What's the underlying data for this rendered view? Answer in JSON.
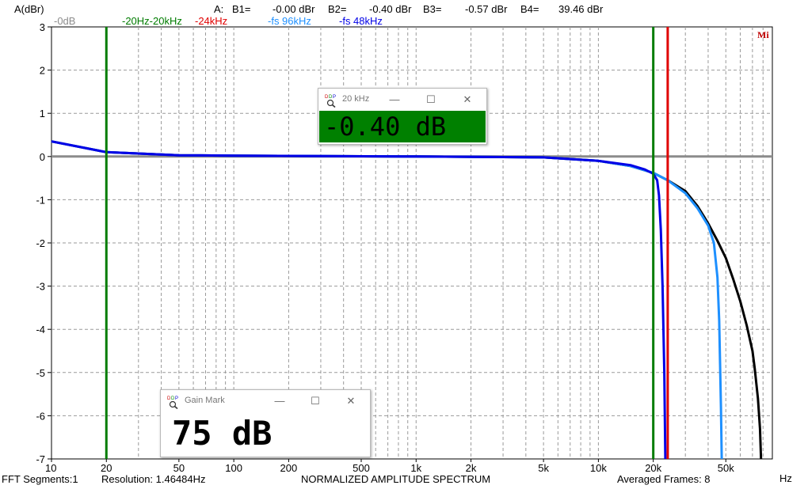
{
  "header": {
    "y_axis_label": "A(dBr)",
    "channel": "A:",
    "b1_label": "B1=",
    "b1_value": "-0.00 dBr",
    "b2_label": "B2=",
    "b2_value": "-0.40 dBr",
    "b3_label": "B3=",
    "b3_value": "-0.57 dBr",
    "b4_label": "B4=",
    "b4_value": "39.46 dBr"
  },
  "legend": {
    "ref_0db": "-0dB",
    "band_20hz_20khz": "-20Hz-20kHz",
    "mark_24khz": "-24kHz",
    "fs_96khz": "-fs 96kHz",
    "fs_48khz": "-fs 48kHz"
  },
  "colors": {
    "ref_gray": "#8c8c8c",
    "band_green": "#007c00",
    "mark_red": "#e00000",
    "fs96_lightblue": "#1e90ff",
    "fs48_blue": "#0000e6",
    "black_trace": "#000000",
    "readout_green": "#008000"
  },
  "footer": {
    "fft_segments": "FFT Segments:1",
    "resolution": "Resolution: 1.46484Hz",
    "title": "NORMALIZED AMPLITUDE SPECTRUM",
    "averaged_frames": "Averaged Frames: 8",
    "x_unit": "Hz"
  },
  "brand": "Mi",
  "window_20khz": {
    "title": "20 kHz",
    "readout": "-0.40 dB",
    "minimize": "—",
    "maximize": "☐",
    "close": "✕"
  },
  "window_gain": {
    "title": "Gain Mark",
    "readout": "75 dB",
    "minimize": "—",
    "maximize": "☐",
    "close": "✕"
  },
  "chart_data": {
    "type": "line",
    "xscale": "log",
    "xlim": [
      10,
      90000
    ],
    "ylim": [
      -7,
      3
    ],
    "grid": true,
    "x_ticks": [
      {
        "v": 10,
        "label": "10"
      },
      {
        "v": 20,
        "label": "20"
      },
      {
        "v": 50,
        "label": "50"
      },
      {
        "v": 100,
        "label": "100"
      },
      {
        "v": 200,
        "label": "200"
      },
      {
        "v": 500,
        "label": "500"
      },
      {
        "v": 1000,
        "label": "1k"
      },
      {
        "v": 2000,
        "label": "2k"
      },
      {
        "v": 5000,
        "label": "5k"
      },
      {
        "v": 10000,
        "label": "10k"
      },
      {
        "v": 20000,
        "label": "20k"
      },
      {
        "v": 50000,
        "label": "50k"
      }
    ],
    "y_ticks": [
      3,
      2,
      1,
      0,
      -1,
      -2,
      -3,
      -4,
      -5,
      -6,
      -7
    ],
    "reference_lines": [
      {
        "axis": "y",
        "value": 0,
        "color": "#8c8c8c"
      },
      {
        "axis": "x",
        "value": 20,
        "color": "#007c00"
      },
      {
        "axis": "x",
        "value": 20000,
        "color": "#007c00"
      },
      {
        "axis": "x",
        "value": 24000,
        "color": "#e00000"
      }
    ],
    "series": [
      {
        "color": "#000000",
        "x": [
          10,
          20,
          50,
          100,
          1000,
          5000,
          10000,
          15000,
          20000,
          24000,
          30000,
          35000,
          40000,
          45000,
          50000,
          55000,
          60000,
          65000,
          70000,
          72000,
          75000,
          77000,
          78000
        ],
        "y": [
          0.35,
          0.1,
          0.03,
          0.02,
          0.0,
          -0.02,
          -0.1,
          -0.22,
          -0.38,
          -0.55,
          -0.8,
          -1.15,
          -1.55,
          -1.95,
          -2.35,
          -2.85,
          -3.35,
          -3.9,
          -4.5,
          -4.9,
          -5.6,
          -6.3,
          -7.0
        ]
      },
      {
        "color": "#1e90ff",
        "x": [
          10,
          20,
          50,
          100,
          1000,
          5000,
          10000,
          15000,
          20000,
          24000,
          30000,
          35000,
          40000,
          43000,
          45000,
          46000,
          46500,
          47000,
          47500
        ],
        "y": [
          0.35,
          0.1,
          0.03,
          0.02,
          0.0,
          -0.02,
          -0.1,
          -0.22,
          -0.38,
          -0.55,
          -0.85,
          -1.2,
          -1.6,
          -2.0,
          -2.8,
          -3.8,
          -4.8,
          -5.8,
          -7.0
        ]
      },
      {
        "color": "#0000e6",
        "x": [
          10,
          20,
          50,
          100,
          1000,
          5000,
          10000,
          15000,
          18000,
          20000,
          21000,
          21500,
          22000,
          22500,
          23000,
          23300
        ],
        "y": [
          0.35,
          0.1,
          0.03,
          0.02,
          0.0,
          -0.02,
          -0.1,
          -0.2,
          -0.3,
          -0.4,
          -0.55,
          -0.9,
          -1.7,
          -3.0,
          -5.0,
          -7.0
        ]
      }
    ]
  }
}
